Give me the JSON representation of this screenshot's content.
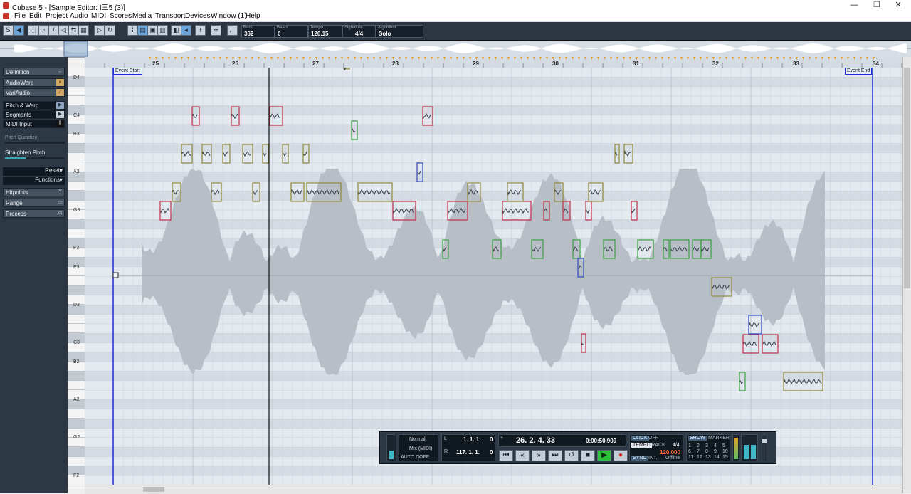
{
  "window": {
    "title": "Cubase 5 - [Sample Editor: I三5 (3)]",
    "minimize": "—",
    "maximize": "❐",
    "close": "✕"
  },
  "menu": [
    "File",
    "Edit",
    "Project",
    "Audio",
    "MIDI",
    "Scores",
    "Media",
    "Transport",
    "Devices",
    "Window (1)",
    "Help"
  ],
  "toolbar": {
    "fields": [
      {
        "label": "Bars",
        "value": "362"
      },
      {
        "label": "Beats",
        "value": "0"
      },
      {
        "label": "Tempo",
        "value": "120.15"
      },
      {
        "label": "Signature",
        "value": "4/4"
      },
      {
        "label": "Algorithm",
        "value": "Solo"
      }
    ]
  },
  "sidebar": {
    "items": [
      {
        "label": "Definition",
        "icon": "arrows-icon"
      },
      {
        "label": "AudioWarp",
        "icon": "warp-icon"
      },
      {
        "label": "VariAudio",
        "icon": "variaudio-icon"
      },
      {
        "label": "Pitch & Warp",
        "icon": "play-arrow-icon"
      },
      {
        "label": "Segments",
        "icon": "play-arrow-icon"
      },
      {
        "label": "MIDI Input",
        "icon": "keyboard-icon"
      }
    ],
    "pitch_quantize": "Pitch Quantize",
    "straighten_pitch": "Straighten Pitch",
    "reset": "Reset",
    "functions": "Functions",
    "bottom_items": [
      {
        "label": "Hitpoints",
        "icon": "hitpoint-icon"
      },
      {
        "label": "Range",
        "icon": "range-icon"
      },
      {
        "label": "Process",
        "icon": "gear-icon"
      }
    ]
  },
  "pitch_labels": [
    "D4",
    "C4",
    "B3",
    "A3",
    "G3",
    "F3",
    "E3",
    "D3",
    "C3",
    "B2",
    "A2",
    "G2",
    "F2"
  ],
  "ruler": {
    "bars": [
      "25",
      "26",
      "27",
      "28",
      "29",
      "30",
      "31",
      "32",
      "33",
      "34"
    ]
  },
  "events": {
    "start": "Event Start",
    "end": "Event End"
  },
  "transport": {
    "mode_top": "Normal",
    "mode_bottom": "Mix (MIDI)",
    "autoq": "AUTO Q",
    "autoq_state": "OFF",
    "left_locator": "1. 1. 1.",
    "left_locator_ticks": "0",
    "right_locator": "117. 1. 1.",
    "right_locator_ticks": "0",
    "position_bars": "26. 2. 4. 33",
    "position_time": "0:00:50.909",
    "click": "CLICK",
    "click_state": "OFF",
    "tempo_label": "TEMPO",
    "track_label": "TRACK",
    "signature": "4/4",
    "tempo_value": "120.000",
    "sync": "SYNC",
    "int": "INT.",
    "offline": "Offline",
    "show": "SHOW",
    "marker": "MARKER",
    "marker_numbers": [
      "1",
      "2",
      "3",
      "4",
      "5",
      "6",
      "7",
      "8",
      "9",
      "10",
      "11",
      "12",
      "13",
      "14",
      "15"
    ]
  },
  "colors": {
    "toolbar_bg": "#2b3642",
    "editor_bg": "#dfe5ec",
    "waveform": "#b8bec6",
    "note_red": "#c0304a",
    "note_olive": "#8e8a3a",
    "note_green": "#3aa040",
    "note_blue": "#3048c0",
    "play_green": "#2fbe3e"
  }
}
